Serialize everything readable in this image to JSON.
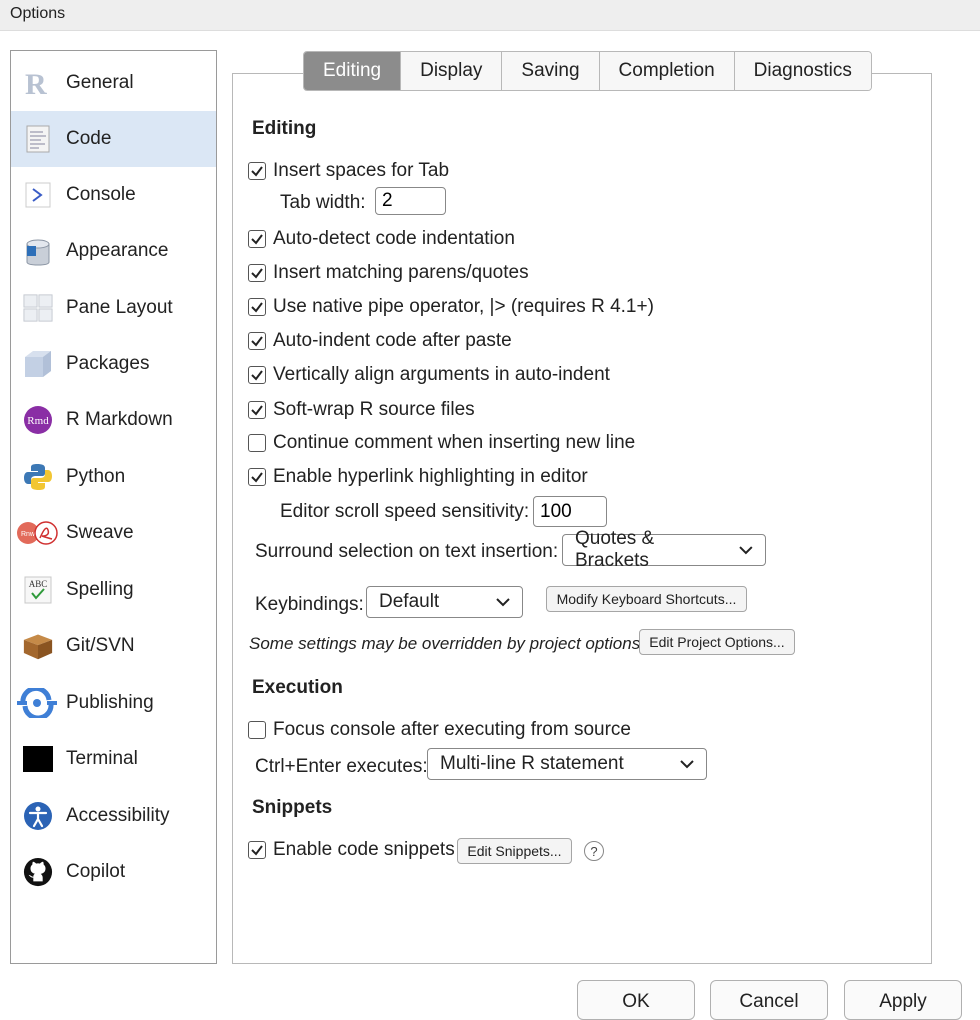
{
  "window": {
    "title": "Options"
  },
  "sidebar": {
    "items": [
      {
        "label": "General",
        "icon": "r-logo-icon"
      },
      {
        "label": "Code",
        "icon": "code-document-icon",
        "active": true
      },
      {
        "label": "Console",
        "icon": "console-prompt-icon"
      },
      {
        "label": "Appearance",
        "icon": "paint-bucket-icon"
      },
      {
        "label": "Pane Layout",
        "icon": "pane-layout-icon"
      },
      {
        "label": "Packages",
        "icon": "package-box-icon"
      },
      {
        "label": "R Markdown",
        "icon": "rmd-icon"
      },
      {
        "label": "Python",
        "icon": "python-logo-icon"
      },
      {
        "label": "Sweave",
        "icon": "sweave-icon"
      },
      {
        "label": "Spelling",
        "icon": "spelling-abc-icon"
      },
      {
        "label": "Git/SVN",
        "icon": "git-box-icon"
      },
      {
        "label": "Publishing",
        "icon": "publishing-icon"
      },
      {
        "label": "Terminal",
        "icon": "terminal-icon"
      },
      {
        "label": "Accessibility",
        "icon": "accessibility-icon"
      },
      {
        "label": "Copilot",
        "icon": "github-icon"
      }
    ]
  },
  "tabs": [
    "Editing",
    "Display",
    "Saving",
    "Completion",
    "Diagnostics"
  ],
  "active_tab": "Editing",
  "editing": {
    "heading": "Editing",
    "insert_spaces": {
      "label": "Insert spaces for Tab",
      "checked": true
    },
    "tab_width_label": "Tab width:",
    "tab_width_value": "2",
    "auto_detect": {
      "label": "Auto-detect code indentation",
      "checked": true
    },
    "matching_parens": {
      "label": "Insert matching parens/quotes",
      "checked": true
    },
    "native_pipe": {
      "label": "Use native pipe operator, |> (requires R 4.1+)",
      "checked": true
    },
    "auto_indent": {
      "label": "Auto-indent code after paste",
      "checked": true
    },
    "vertical_align": {
      "label": "Vertically align arguments in auto-indent",
      "checked": true
    },
    "soft_wrap": {
      "label": "Soft-wrap R source files",
      "checked": true
    },
    "continue_comment": {
      "label": "Continue comment when inserting new line",
      "checked": false
    },
    "hyperlink": {
      "label": "Enable hyperlink highlighting in editor",
      "checked": true
    },
    "scroll_label": "Editor scroll speed sensitivity:",
    "scroll_value": "100",
    "surround_label": "Surround selection on text insertion:",
    "surround_value": "Quotes & Brackets",
    "keybindings_label": "Keybindings:",
    "keybindings_value": "Default",
    "modify_shortcuts": "Modify Keyboard Shortcuts...",
    "note": "Some settings may be overridden by project options.",
    "edit_project": "Edit Project Options..."
  },
  "execution": {
    "heading": "Execution",
    "focus_console": {
      "label": "Focus console after executing from source",
      "checked": false
    },
    "ctrl_enter_label": "Ctrl+Enter executes:",
    "ctrl_enter_value": "Multi-line R statement"
  },
  "snippets": {
    "heading": "Snippets",
    "enable": {
      "label": "Enable code snippets",
      "checked": true
    },
    "edit_button": "Edit Snippets...",
    "help": "?"
  },
  "buttons": {
    "ok": "OK",
    "cancel": "Cancel",
    "apply": "Apply"
  }
}
